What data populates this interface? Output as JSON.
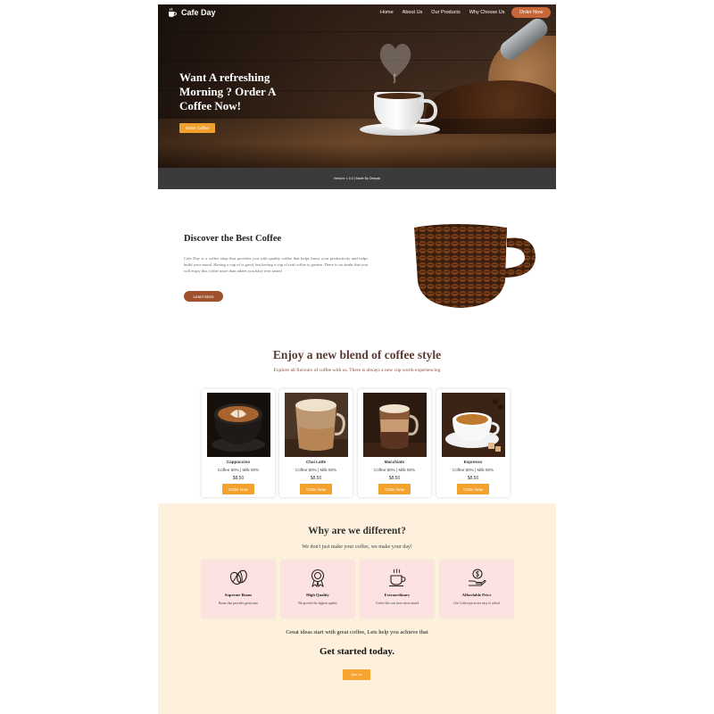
{
  "nav": {
    "brand": "Cafe Day",
    "links": [
      "Home",
      "About Us",
      "Our Products",
      "Why Choose Us"
    ],
    "cta": "Order Now"
  },
  "hero": {
    "title": "Want A refreshing Morning ? Order A Coffee Now!",
    "button": "Order Coffee",
    "version": "Version: 1.0.0 | Made By Deepak"
  },
  "discover": {
    "title": "Discover the Best Coffee",
    "text": "Cafe Day is a coffee shop that provides you with quality coffee that helps boost your productivity and helps build your mood. Having a cup of is good, but having a cup of real coffee is greater. There is no doubt that you will enjoy this coffee more than others you have ever tasted",
    "button": "Learn More"
  },
  "blend": {
    "title": "Enjoy a new blend of coffee style",
    "subtitle": "Explore all flavours of coffee with us. There is always a new cup worth experiencing",
    "products": [
      {
        "name": "Cappuccino",
        "desc": "Coffee 50% | Milk 50%",
        "price": "$8.50",
        "button": "Order Now"
      },
      {
        "name": "Chai Latte",
        "desc": "Coffee 50% | Milk 50%",
        "price": "$8.50",
        "button": "Order Now"
      },
      {
        "name": "Macchiato",
        "desc": "Coffee 50% | Milk 50%",
        "price": "$8.50",
        "button": "Order Now"
      },
      {
        "name": "Expresso",
        "desc": "Coffee 50% | Milk 50%",
        "price": "$8.50",
        "button": "Order Now"
      }
    ]
  },
  "different": {
    "title": "Why are we different?",
    "subtitle": "We don't just make your coffee, we make your day!",
    "features": [
      {
        "icon": "coffee-bean-icon",
        "name": "Supreme Beans",
        "desc": "Beans that provides great taste"
      },
      {
        "icon": "award-ribbon-icon",
        "name": "High Quality",
        "desc": "We provide the highest quality"
      },
      {
        "icon": "coffee-cup-icon",
        "name": "Extraordinary",
        "desc": "Coffee like you have never tasted"
      },
      {
        "icon": "price-hand-icon",
        "name": "Affordable Price",
        "desc": "Our Coffee prices are easy to afford"
      }
    ],
    "tagline": "Great ideas start with great coffee, Lets help you achieve that",
    "cta_title": "Get started today.",
    "button": "Join Us"
  },
  "colors": {
    "accent_orange": "#f4a22e",
    "brown": "#a0522d",
    "cream": "#fdf0dc",
    "pink": "#fde2e2"
  }
}
